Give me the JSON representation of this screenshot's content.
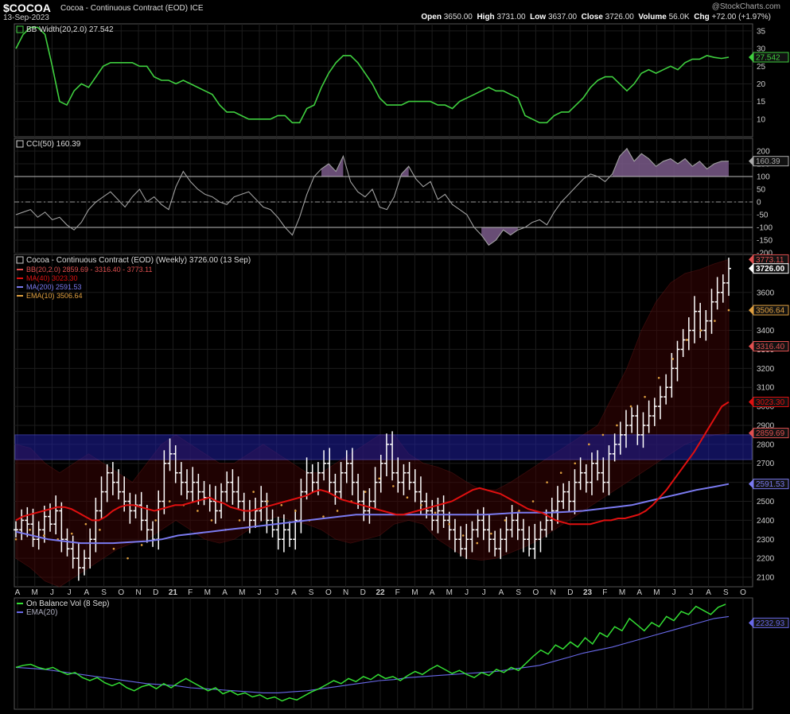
{
  "header": {
    "symbol": "$COCOA",
    "name": "Cocoa - Continuous Contract (EOD)",
    "exchange": "ICE",
    "date": "13-Sep-2023",
    "watermark": "@StockCharts.com",
    "open_label": "Open",
    "open": "3650.00",
    "high_label": "High",
    "high": "3731.00",
    "low_label": "Low",
    "low": "3637.00",
    "close_label": "Close",
    "close": "3726.00",
    "volume_label": "Volume",
    "volume": "56.0K",
    "chg_label": "Chg",
    "chg": "+72.00 (+1.97%)"
  },
  "colors": {
    "bbw": "#3fcf3f",
    "cci": "#a0a0a0",
    "cci_fill": "#7a5a8a",
    "price": "#ffffff",
    "ma40": "#e01010",
    "ma200": "#7a7af0",
    "ema10": "#e0a040",
    "obv": "#33dd33",
    "obv_ema": "#6868e8",
    "zone": "#2020a0"
  },
  "chart_data": [
    {
      "type": "line",
      "panel": "bb-width",
      "legend": "BB Width(20,2.0) 27.542",
      "last_value_label": "27.542",
      "ylim": [
        5,
        37
      ],
      "yticks": [
        10,
        15,
        20,
        25,
        30,
        35
      ],
      "series": [
        {
          "name": "BB Width(20,2.0)",
          "values": [
            30,
            34,
            36,
            36,
            34,
            25,
            15,
            14,
            18,
            20,
            19,
            22,
            25,
            26,
            26,
            26,
            26,
            25,
            25,
            22,
            21,
            21,
            20,
            21,
            20,
            19,
            18,
            17,
            14,
            12,
            12,
            11,
            10,
            10,
            10,
            10,
            11,
            11,
            9,
            9,
            13,
            14,
            19,
            23,
            26,
            28,
            28,
            26,
            23,
            20,
            16,
            14,
            14,
            14,
            15,
            15,
            15,
            15,
            14,
            14,
            13,
            15,
            16,
            17,
            18,
            19,
            18,
            18,
            17,
            16,
            11,
            10,
            9,
            9,
            11,
            12,
            12,
            14,
            16,
            19,
            21,
            22,
            22,
            20,
            18,
            20,
            23,
            24,
            23,
            24,
            25,
            24,
            26,
            27,
            27,
            28,
            27.5,
            27.2,
            27.542
          ]
        }
      ]
    },
    {
      "type": "line",
      "panel": "cci",
      "legend": "CCI(50) 160.39",
      "last_value_label": "160.39",
      "ylim": [
        -200,
        250
      ],
      "yticks": [
        -200,
        -150,
        -100,
        -50,
        0,
        50,
        100,
        150,
        200
      ],
      "reference_lines": [
        100,
        -100
      ],
      "zero_line": 0,
      "series": [
        {
          "name": "CCI(50)",
          "values": [
            -50,
            -40,
            -30,
            -60,
            -40,
            -70,
            -60,
            -90,
            -110,
            -80,
            -30,
            0,
            20,
            40,
            10,
            -20,
            20,
            50,
            0,
            20,
            -10,
            -30,
            60,
            120,
            80,
            50,
            30,
            20,
            0,
            -10,
            20,
            30,
            40,
            10,
            -20,
            -30,
            -60,
            -100,
            -130,
            -60,
            30,
            100,
            130,
            150,
            120,
            180,
            80,
            40,
            20,
            50,
            -20,
            -30,
            20,
            110,
            140,
            90,
            60,
            80,
            10,
            30,
            -10,
            -30,
            -50,
            -100,
            -130,
            -170,
            -150,
            -110,
            -130,
            -110,
            -100,
            -80,
            -70,
            -90,
            -40,
            0,
            30,
            60,
            90,
            110,
            100,
            80,
            110,
            180,
            210,
            160,
            190,
            170,
            140,
            160,
            170,
            150,
            170,
            140,
            160,
            130,
            150,
            160,
            160.39
          ]
        }
      ]
    },
    {
      "type": "ohlc",
      "panel": "price",
      "title": "Cocoa - Continuous Contract (EOD) (Weekly) 3726.00 (13 Sep)",
      "legend": [
        {
          "label": "BB(20,2.0) 2859.69 - 3316.40 - 3773.11",
          "color": "#e05050"
        },
        {
          "label": "MA(40) 3023.30",
          "color": "#e01010"
        },
        {
          "label": "MA(200) 2591.53",
          "color": "#7a7af0"
        },
        {
          "label": "EMA(10) 3506.64",
          "color": "#e0a040"
        }
      ],
      "ylim": [
        2050,
        3800
      ],
      "yticks": [
        2100,
        2200,
        2300,
        2400,
        2500,
        2600,
        2700,
        2800,
        2900,
        3000,
        3100,
        3200,
        3300,
        3400,
        3500,
        3600
      ],
      "value_tags": [
        {
          "label": "3773.11",
          "value": 3773.11,
          "color": "#e05050"
        },
        {
          "label": "3726.00",
          "value": 3726,
          "color": "#ffffff",
          "bold": true
        },
        {
          "label": "3506.64",
          "value": 3506.64,
          "color": "#e0a040"
        },
        {
          "label": "3316.40",
          "value": 3316.4,
          "color": "#e05050"
        },
        {
          "label": "3023.30",
          "value": 3023.3,
          "color": "#e01010"
        },
        {
          "label": "2859.69",
          "value": 2859.69,
          "color": "#e05050"
        },
        {
          "label": "2591.53",
          "value": 2591.53,
          "color": "#7a7af0"
        }
      ],
      "zone": {
        "low": 2720,
        "high": 2850
      },
      "x_labels": [
        "A",
        "M",
        "J",
        "J",
        "A",
        "S",
        "O",
        "N",
        "D",
        "21",
        "F",
        "M",
        "A",
        "M",
        "J",
        "J",
        "A",
        "S",
        "O",
        "N",
        "D",
        "22",
        "F",
        "M",
        "A",
        "M",
        "J",
        "J",
        "A",
        "S",
        "O",
        "N",
        "D",
        "23",
        "F",
        "M",
        "A",
        "M",
        "J",
        "J",
        "A",
        "S",
        "O"
      ],
      "close": [
        2350,
        2400,
        2380,
        2300,
        2350,
        2420,
        2380,
        2450,
        2300,
        2250,
        2200,
        2150,
        2200,
        2300,
        2450,
        2550,
        2650,
        2600,
        2550,
        2500,
        2450,
        2480,
        2400,
        2350,
        2300,
        2500,
        2700,
        2750,
        2650,
        2600,
        2550,
        2600,
        2550,
        2520,
        2500,
        2450,
        2550,
        2600,
        2550,
        2500,
        2450,
        2400,
        2450,
        2500,
        2400,
        2350,
        2300,
        2350,
        2300,
        2400,
        2550,
        2650,
        2600,
        2650,
        2700,
        2600,
        2550,
        2650,
        2700,
        2600,
        2500,
        2450,
        2500,
        2600,
        2700,
        2800,
        2650,
        2600,
        2650,
        2600,
        2550,
        2500,
        2450,
        2400,
        2450,
        2400,
        2350,
        2300,
        2250,
        2300,
        2350,
        2400,
        2350,
        2300,
        2250,
        2300,
        2350,
        2400,
        2350,
        2300,
        2250,
        2300,
        2350,
        2400,
        2450,
        2500,
        2550,
        2500,
        2600,
        2650,
        2600,
        2700,
        2650,
        2600,
        2750,
        2800,
        2850,
        2900,
        2950,
        2850,
        2900,
        2950,
        3000,
        3050,
        3100,
        3200,
        3300,
        3350,
        3400,
        3500,
        3400,
        3450,
        3550,
        3600,
        3650,
        3726
      ],
      "ma40": [
        2400,
        2420,
        2430,
        2440,
        2450,
        2460,
        2470,
        2470,
        2460,
        2440,
        2420,
        2400,
        2400,
        2420,
        2450,
        2470,
        2480,
        2480,
        2470,
        2460,
        2450,
        2460,
        2470,
        2480,
        2480,
        2490,
        2500,
        2510,
        2520,
        2500,
        2490,
        2470,
        2460,
        2450,
        2450,
        2460,
        2470,
        2480,
        2490,
        2500,
        2510,
        2520,
        2530,
        2550,
        2560,
        2550,
        2530,
        2510,
        2500,
        2490,
        2480,
        2470,
        2460,
        2450,
        2440,
        2430,
        2430,
        2440,
        2450,
        2460,
        2470,
        2480,
        2490,
        2500,
        2520,
        2540,
        2560,
        2570,
        2560,
        2550,
        2540,
        2520,
        2500,
        2480,
        2460,
        2450,
        2440,
        2420,
        2400,
        2390,
        2380,
        2380,
        2380,
        2380,
        2390,
        2400,
        2400,
        2410,
        2410,
        2420,
        2430,
        2450,
        2480,
        2520,
        2560,
        2610,
        2660,
        2710,
        2760,
        2820,
        2880,
        2940,
        3000,
        3023
      ],
      "ma200": [
        2340,
        2320,
        2300,
        2290,
        2280,
        2280,
        2280,
        2285,
        2290,
        2300,
        2320,
        2330,
        2340,
        2350,
        2360,
        2370,
        2380,
        2390,
        2400,
        2410,
        2420,
        2430,
        2430,
        2430,
        2430,
        2430,
        2430,
        2430,
        2430,
        2430,
        2435,
        2440,
        2440,
        2440,
        2445,
        2450,
        2460,
        2470,
        2480,
        2500,
        2520,
        2540,
        2560,
        2575,
        2591.53
      ],
      "ema10": [
        2300,
        2350,
        2320,
        2300,
        2330,
        2380,
        2350,
        2250,
        2200,
        2270,
        2400,
        2500,
        2480,
        2450,
        2400,
        2350,
        2400,
        2550,
        2500,
        2480,
        2450,
        2400,
        2420,
        2450,
        2500,
        2550,
        2620,
        2580,
        2520,
        2480,
        2440,
        2380,
        2320,
        2280,
        2330,
        2400,
        2450,
        2500,
        2600,
        2650,
        2700,
        2800,
        2850,
        2900,
        3000,
        3050,
        3150,
        3250,
        3350,
        3400,
        3450,
        3506.64
      ],
      "bb_upper": [
        2800,
        2780,
        2700,
        2650,
        2700,
        2750,
        2700,
        2650,
        2600,
        2700,
        2800,
        2850,
        2800,
        2750,
        2700,
        2700,
        2750,
        2800,
        2750,
        2700,
        2650,
        2650,
        2700,
        2750,
        2800,
        2850,
        2850,
        2750,
        2700,
        2680,
        2650,
        2600,
        2560,
        2560,
        2600,
        2650,
        2700,
        2750,
        2800,
        2850,
        2900,
        3050,
        3200,
        3400,
        3550,
        3650,
        3700,
        3720,
        3750,
        3773.11
      ],
      "bb_lower": [
        2200,
        2150,
        2080,
        2050,
        2100,
        2150,
        2200,
        2250,
        2280,
        2300,
        2350,
        2400,
        2350,
        2300,
        2280,
        2300,
        2350,
        2400,
        2420,
        2400,
        2380,
        2350,
        2300,
        2280,
        2300,
        2320,
        2380,
        2400,
        2380,
        2300,
        2250,
        2200,
        2190,
        2200,
        2230,
        2260,
        2300,
        2350,
        2400,
        2450,
        2500,
        2550,
        2600,
        2650,
        2700,
        2750,
        2800,
        2830,
        2850,
        2859.69
      ]
    },
    {
      "type": "line",
      "panel": "obv",
      "legend": "On Balance Vol (8 Sep)",
      "legend2": "EMA(20)",
      "last_value_label": "2232.93",
      "ylim": [
        0,
        100
      ],
      "series": [
        {
          "name": "On Balance Vol",
          "values": [
            38,
            40,
            41,
            38,
            36,
            38,
            34,
            31,
            33,
            28,
            25,
            28,
            23,
            20,
            23,
            18,
            15,
            19,
            21,
            17,
            22,
            18,
            23,
            27,
            23,
            19,
            15,
            18,
            12,
            15,
            11,
            13,
            9,
            11,
            7,
            9,
            5,
            8,
            6,
            10,
            14,
            17,
            21,
            25,
            22,
            27,
            24,
            29,
            26,
            31,
            27,
            29,
            25,
            30,
            34,
            31,
            36,
            40,
            36,
            32,
            35,
            31,
            28,
            33,
            30,
            36,
            33,
            38,
            35,
            42,
            49,
            55,
            51,
            60,
            56,
            63,
            58,
            67,
            61,
            72,
            68,
            78,
            74,
            86,
            80,
            74,
            82,
            78,
            88,
            84,
            93,
            90,
            98,
            94,
            90,
            97,
            100
          ]
        },
        {
          "name": "EMA(20)",
          "values": [
            38,
            37,
            36,
            34,
            32,
            30,
            28,
            26,
            24,
            22,
            21,
            20,
            18,
            17,
            16,
            15,
            14,
            13,
            13,
            14,
            15,
            17,
            19,
            21,
            23,
            25,
            26,
            28,
            29,
            30,
            31,
            32,
            33,
            34,
            36,
            38,
            40,
            44,
            48,
            52,
            55,
            58,
            62,
            66,
            70,
            74,
            78,
            82,
            86,
            88
          ]
        }
      ]
    }
  ]
}
